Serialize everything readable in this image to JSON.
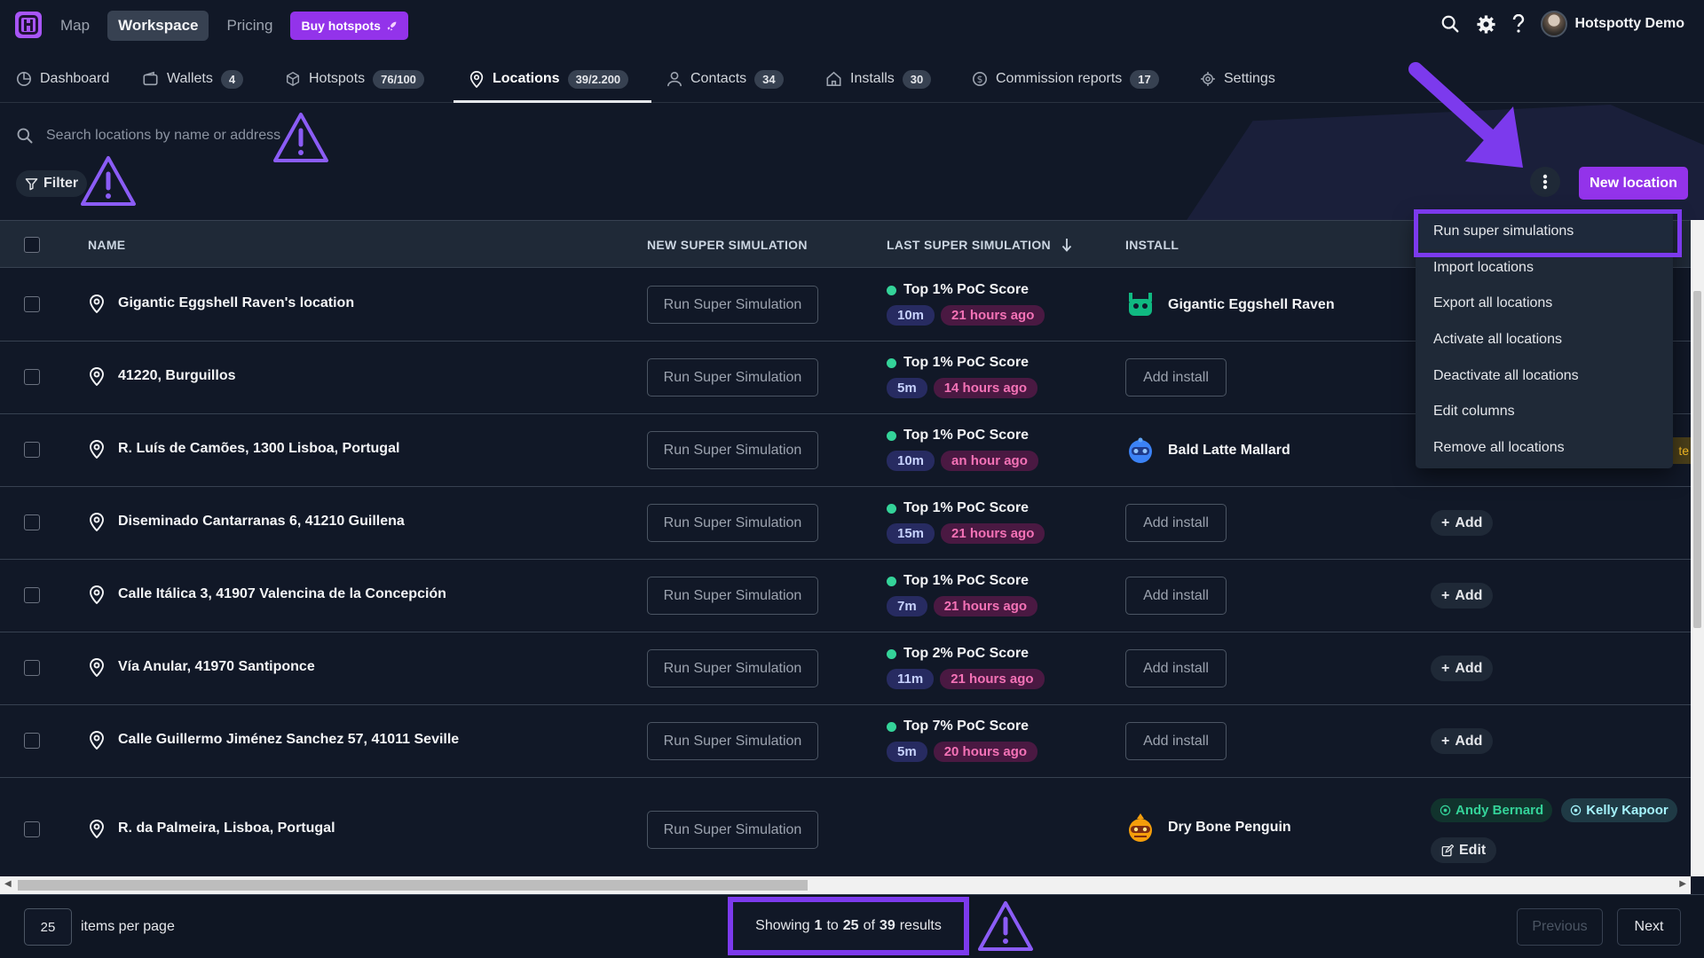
{
  "topnav": {
    "items": [
      "Map",
      "Workspace",
      "Pricing"
    ],
    "buy_label": "Buy hotspots",
    "user_name": "Hotspotty Demo"
  },
  "tabs": [
    {
      "label": "Dashboard",
      "badge": "",
      "icon": "pie-chart-icon"
    },
    {
      "label": "Wallets",
      "badge": "4",
      "icon": "wallet-icon"
    },
    {
      "label": "Hotspots",
      "badge": "76/100",
      "icon": "cube-icon"
    },
    {
      "label": "Locations",
      "badge": "39/2.200",
      "icon": "map-pin-icon"
    },
    {
      "label": "Contacts",
      "badge": "34",
      "icon": "user-icon"
    },
    {
      "label": "Installs",
      "badge": "30",
      "icon": "home-icon"
    },
    {
      "label": "Commission reports",
      "badge": "17",
      "icon": "dollar-icon"
    },
    {
      "label": "Settings",
      "badge": "",
      "icon": "gear-icon"
    }
  ],
  "search": {
    "placeholder": "Search locations by name or address"
  },
  "filter_label": "Filter",
  "new_location_label": "New location",
  "table": {
    "columns": [
      "NAME",
      "NEW SUPER SIMULATION",
      "LAST SUPER SIMULATION",
      "INSTALL"
    ],
    "run_label": "Run Super Simulation",
    "add_install_label": "Add install",
    "add_label": "Add",
    "edit_label": "Edit",
    "rows": [
      {
        "name": "Gigantic Eggshell Raven's location",
        "score": "Top 1% PoC Score",
        "duration": "10m",
        "ago": "21 hours ago",
        "install": "Gigantic Eggshell Raven"
      },
      {
        "name": "41220, Burguillos",
        "score": "Top 1% PoC Score",
        "duration": "5m",
        "ago": "14 hours ago",
        "install": ""
      },
      {
        "name": "R. Luís de Camões, 1300 Lisboa, Portugal",
        "score": "Top 1% PoC Score",
        "duration": "10m",
        "ago": "an hour ago",
        "install": "Bald Latte Mallard"
      },
      {
        "name": "Diseminado Cantarranas 6, 41210 Guillena",
        "score": "Top 1% PoC Score",
        "duration": "15m",
        "ago": "21 hours ago",
        "install": ""
      },
      {
        "name": "Calle Itálica 3, 41907 Valencina de la Concepción",
        "score": "Top 1% PoC Score",
        "duration": "7m",
        "ago": "21 hours ago",
        "install": ""
      },
      {
        "name": "Vía Anular, 41970 Santiponce",
        "score": "Top 2% PoC Score",
        "duration": "11m",
        "ago": "21 hours ago",
        "install": ""
      },
      {
        "name": "Calle Guillermo Jiménez Sanchez 57, 41011 Seville",
        "score": "Top 7% PoC Score",
        "duration": "5m",
        "ago": "20 hours ago",
        "install": ""
      },
      {
        "name": "R. da Palmeira, Lisboa, Portugal",
        "score": "",
        "duration": "",
        "ago": "",
        "install": "Dry Bone Penguin",
        "contacts": [
          "Andy Bernard",
          "Kelly Kapoor"
        ]
      }
    ]
  },
  "menu": {
    "items": [
      "Run super simulations",
      "Import locations",
      "Export all locations",
      "Activate all locations",
      "Deactivate all locations",
      "Edit columns",
      "Remove all locations"
    ]
  },
  "pagination": {
    "per_page": "25",
    "per_page_label": "items per page",
    "showing_prefix": "Showing",
    "from": "1",
    "to_word": "to",
    "to": "25",
    "of_word": "of",
    "total": "39",
    "results_word": "results",
    "previous_label": "Previous",
    "next_label": "Next"
  },
  "colors": {
    "accent": "#9333ea",
    "highlight": "#7c3aed",
    "success": "#34d399",
    "background": "#111827"
  }
}
